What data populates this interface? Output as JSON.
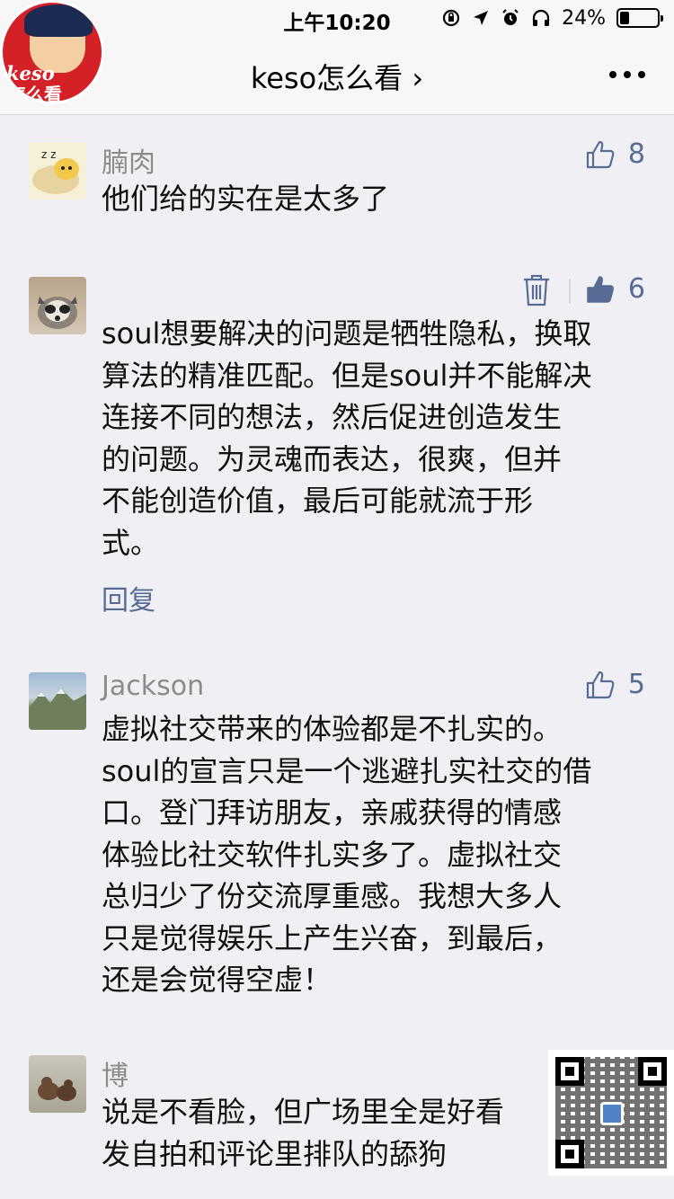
{
  "status_bar": {
    "time": "上午10:20",
    "battery": "24%",
    "battery_level": 0.24
  },
  "logo": {
    "text_en": "keso",
    "text_cn": "怎么看"
  },
  "nav": {
    "title": "keso怎么看 ›"
  },
  "comments": [
    {
      "name": "腩肉",
      "likes": "8",
      "text": [
        "他们给的实在是太多了"
      ]
    },
    {
      "name": "",
      "likes": "6",
      "reply": "回复",
      "text": [
        "soul想要解决的问题是牺牲隐私，换取",
        "算法的精准匹配。但是soul并不能解决",
        "连接不同的想法，然后促进创造发生",
        "的问题。为灵魂而表达，很爽，但并",
        "不能创造价值，最后可能就流于形",
        "式。"
      ]
    },
    {
      "name": "Jackson",
      "likes": "5",
      "text": [
        "虚拟社交带来的体验都是不扎实的。",
        "soul的宣言只是一个逃避扎实社交的借",
        "口。登门拜访朋友，亲戚获得的情感",
        "体验比社交软件扎实多了。虚拟社交",
        "总归少了份交流厚重感。我想大多人",
        "只是觉得娱乐上产生兴奋，到最后，",
        "还是会觉得空虚！"
      ]
    },
    {
      "name": "博",
      "text": [
        "说是不看脸，但广场里全是好看",
        "发自拍和评论里排队的舔狗"
      ]
    }
  ],
  "colors": {
    "link": "#576b95",
    "background": "#efeff4",
    "logo_red": "#d42027"
  }
}
